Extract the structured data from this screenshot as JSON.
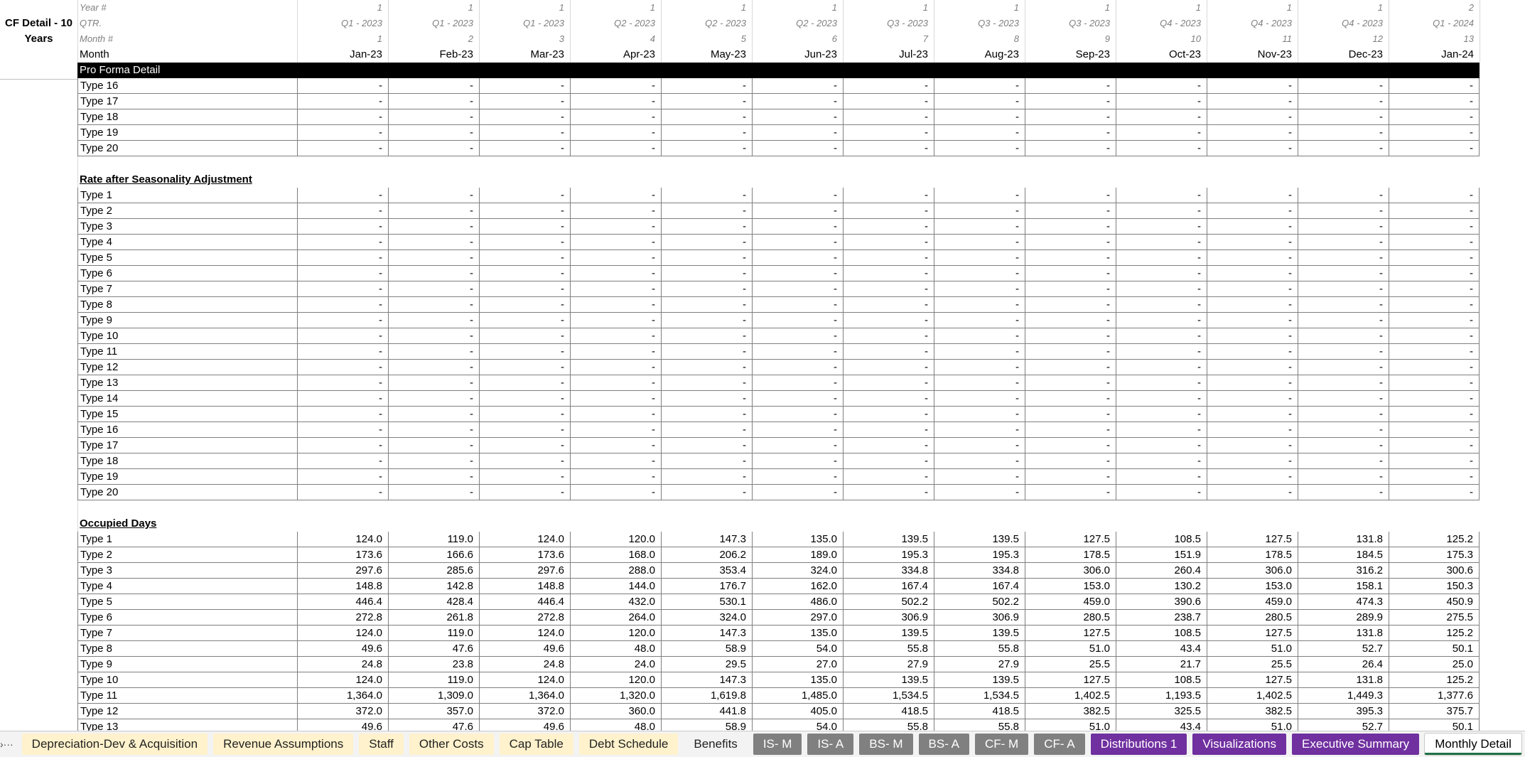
{
  "sheet_title": "CF Detail - 10 Years",
  "header_rows": [
    {
      "label": "Year #",
      "values": [
        "1",
        "1",
        "1",
        "1",
        "1",
        "1",
        "1",
        "1",
        "1",
        "1",
        "1",
        "1",
        "2"
      ],
      "style": "hdr"
    },
    {
      "label": "QTR.",
      "values": [
        "Q1 - 2023",
        "Q1 - 2023",
        "Q1 - 2023",
        "Q2 - 2023",
        "Q2 - 2023",
        "Q2 - 2023",
        "Q3 - 2023",
        "Q3 - 2023",
        "Q3 - 2023",
        "Q4 - 2023",
        "Q4 - 2023",
        "Q4 - 2023",
        "Q1 - 2024"
      ],
      "style": "hdr"
    },
    {
      "label": "Month #",
      "values": [
        "1",
        "2",
        "3",
        "4",
        "5",
        "6",
        "7",
        "8",
        "9",
        "10",
        "11",
        "12",
        "13"
      ],
      "style": "hdr"
    },
    {
      "label": "Month",
      "values": [
        "Jan-23",
        "Feb-23",
        "Mar-23",
        "Apr-23",
        "May-23",
        "Jun-23",
        "Jul-23",
        "Aug-23",
        "Sep-23",
        "Oct-23",
        "Nov-23",
        "Dec-23",
        "Jan-24"
      ],
      "style": "month"
    }
  ],
  "banner": "Pro Forma Detail",
  "block1_rows": [
    {
      "label": "Type 16",
      "values": [
        "-",
        "-",
        "-",
        "-",
        "-",
        "-",
        "-",
        "-",
        "-",
        "-",
        "-",
        "-",
        "-"
      ]
    },
    {
      "label": "Type 17",
      "values": [
        "-",
        "-",
        "-",
        "-",
        "-",
        "-",
        "-",
        "-",
        "-",
        "-",
        "-",
        "-",
        "-"
      ]
    },
    {
      "label": "Type 18",
      "values": [
        "-",
        "-",
        "-",
        "-",
        "-",
        "-",
        "-",
        "-",
        "-",
        "-",
        "-",
        "-",
        "-"
      ]
    },
    {
      "label": "Type 19",
      "values": [
        "-",
        "-",
        "-",
        "-",
        "-",
        "-",
        "-",
        "-",
        "-",
        "-",
        "-",
        "-",
        "-"
      ]
    },
    {
      "label": "Type 20",
      "values": [
        "-",
        "-",
        "-",
        "-",
        "-",
        "-",
        "-",
        "-",
        "-",
        "-",
        "-",
        "-",
        "-"
      ]
    }
  ],
  "section2_title": "Rate after Seasonality Adjustment",
  "section2_rows": [
    {
      "label": "Type 1",
      "values": [
        "-",
        "-",
        "-",
        "-",
        "-",
        "-",
        "-",
        "-",
        "-",
        "-",
        "-",
        "-",
        "-"
      ]
    },
    {
      "label": "Type 2",
      "values": [
        "-",
        "-",
        "-",
        "-",
        "-",
        "-",
        "-",
        "-",
        "-",
        "-",
        "-",
        "-",
        "-"
      ]
    },
    {
      "label": "Type 3",
      "values": [
        "-",
        "-",
        "-",
        "-",
        "-",
        "-",
        "-",
        "-",
        "-",
        "-",
        "-",
        "-",
        "-"
      ]
    },
    {
      "label": "Type 4",
      "values": [
        "-",
        "-",
        "-",
        "-",
        "-",
        "-",
        "-",
        "-",
        "-",
        "-",
        "-",
        "-",
        "-"
      ]
    },
    {
      "label": "Type 5",
      "values": [
        "-",
        "-",
        "-",
        "-",
        "-",
        "-",
        "-",
        "-",
        "-",
        "-",
        "-",
        "-",
        "-"
      ]
    },
    {
      "label": "Type 6",
      "values": [
        "-",
        "-",
        "-",
        "-",
        "-",
        "-",
        "-",
        "-",
        "-",
        "-",
        "-",
        "-",
        "-"
      ]
    },
    {
      "label": "Type 7",
      "values": [
        "-",
        "-",
        "-",
        "-",
        "-",
        "-",
        "-",
        "-",
        "-",
        "-",
        "-",
        "-",
        "-"
      ]
    },
    {
      "label": "Type 8",
      "values": [
        "-",
        "-",
        "-",
        "-",
        "-",
        "-",
        "-",
        "-",
        "-",
        "-",
        "-",
        "-",
        "-"
      ]
    },
    {
      "label": "Type 9",
      "values": [
        "-",
        "-",
        "-",
        "-",
        "-",
        "-",
        "-",
        "-",
        "-",
        "-",
        "-",
        "-",
        "-"
      ]
    },
    {
      "label": "Type 10",
      "values": [
        "-",
        "-",
        "-",
        "-",
        "-",
        "-",
        "-",
        "-",
        "-",
        "-",
        "-",
        "-",
        "-"
      ]
    },
    {
      "label": "Type 11",
      "values": [
        "-",
        "-",
        "-",
        "-",
        "-",
        "-",
        "-",
        "-",
        "-",
        "-",
        "-",
        "-",
        "-"
      ]
    },
    {
      "label": "Type 12",
      "values": [
        "-",
        "-",
        "-",
        "-",
        "-",
        "-",
        "-",
        "-",
        "-",
        "-",
        "-",
        "-",
        "-"
      ]
    },
    {
      "label": "Type 13",
      "values": [
        "-",
        "-",
        "-",
        "-",
        "-",
        "-",
        "-",
        "-",
        "-",
        "-",
        "-",
        "-",
        "-"
      ]
    },
    {
      "label": "Type 14",
      "values": [
        "-",
        "-",
        "-",
        "-",
        "-",
        "-",
        "-",
        "-",
        "-",
        "-",
        "-",
        "-",
        "-"
      ]
    },
    {
      "label": "Type 15",
      "values": [
        "-",
        "-",
        "-",
        "-",
        "-",
        "-",
        "-",
        "-",
        "-",
        "-",
        "-",
        "-",
        "-"
      ]
    },
    {
      "label": "Type 16",
      "values": [
        "-",
        "-",
        "-",
        "-",
        "-",
        "-",
        "-",
        "-",
        "-",
        "-",
        "-",
        "-",
        "-"
      ]
    },
    {
      "label": "Type 17",
      "values": [
        "-",
        "-",
        "-",
        "-",
        "-",
        "-",
        "-",
        "-",
        "-",
        "-",
        "-",
        "-",
        "-"
      ]
    },
    {
      "label": "Type 18",
      "values": [
        "-",
        "-",
        "-",
        "-",
        "-",
        "-",
        "-",
        "-",
        "-",
        "-",
        "-",
        "-",
        "-"
      ]
    },
    {
      "label": "Type 19",
      "values": [
        "-",
        "-",
        "-",
        "-",
        "-",
        "-",
        "-",
        "-",
        "-",
        "-",
        "-",
        "-",
        "-"
      ]
    },
    {
      "label": "Type 20",
      "values": [
        "-",
        "-",
        "-",
        "-",
        "-",
        "-",
        "-",
        "-",
        "-",
        "-",
        "-",
        "-",
        "-"
      ]
    }
  ],
  "section3_title": "Occupied Days",
  "section3_rows": [
    {
      "label": "Type 1",
      "values": [
        "124.0",
        "119.0",
        "124.0",
        "120.0",
        "147.3",
        "135.0",
        "139.5",
        "139.5",
        "127.5",
        "108.5",
        "127.5",
        "131.8",
        "125.2"
      ]
    },
    {
      "label": "Type 2",
      "values": [
        "173.6",
        "166.6",
        "173.6",
        "168.0",
        "206.2",
        "189.0",
        "195.3",
        "195.3",
        "178.5",
        "151.9",
        "178.5",
        "184.5",
        "175.3"
      ]
    },
    {
      "label": "Type 3",
      "values": [
        "297.6",
        "285.6",
        "297.6",
        "288.0",
        "353.4",
        "324.0",
        "334.8",
        "334.8",
        "306.0",
        "260.4",
        "306.0",
        "316.2",
        "300.6"
      ]
    },
    {
      "label": "Type 4",
      "values": [
        "148.8",
        "142.8",
        "148.8",
        "144.0",
        "176.7",
        "162.0",
        "167.4",
        "167.4",
        "153.0",
        "130.2",
        "153.0",
        "158.1",
        "150.3"
      ]
    },
    {
      "label": "Type 5",
      "values": [
        "446.4",
        "428.4",
        "446.4",
        "432.0",
        "530.1",
        "486.0",
        "502.2",
        "502.2",
        "459.0",
        "390.6",
        "459.0",
        "474.3",
        "450.9"
      ]
    },
    {
      "label": "Type 6",
      "values": [
        "272.8",
        "261.8",
        "272.8",
        "264.0",
        "324.0",
        "297.0",
        "306.9",
        "306.9",
        "280.5",
        "238.7",
        "280.5",
        "289.9",
        "275.5"
      ]
    },
    {
      "label": "Type 7",
      "values": [
        "124.0",
        "119.0",
        "124.0",
        "120.0",
        "147.3",
        "135.0",
        "139.5",
        "139.5",
        "127.5",
        "108.5",
        "127.5",
        "131.8",
        "125.2"
      ]
    },
    {
      "label": "Type 8",
      "values": [
        "49.6",
        "47.6",
        "49.6",
        "48.0",
        "58.9",
        "54.0",
        "55.8",
        "55.8",
        "51.0",
        "43.4",
        "51.0",
        "52.7",
        "50.1"
      ]
    },
    {
      "label": "Type 9",
      "values": [
        "24.8",
        "23.8",
        "24.8",
        "24.0",
        "29.5",
        "27.0",
        "27.9",
        "27.9",
        "25.5",
        "21.7",
        "25.5",
        "26.4",
        "25.0"
      ]
    },
    {
      "label": "Type 10",
      "values": [
        "124.0",
        "119.0",
        "124.0",
        "120.0",
        "147.3",
        "135.0",
        "139.5",
        "139.5",
        "127.5",
        "108.5",
        "127.5",
        "131.8",
        "125.2"
      ]
    },
    {
      "label": "Type 11",
      "values": [
        "1,364.0",
        "1,309.0",
        "1,364.0",
        "1,320.0",
        "1,619.8",
        "1,485.0",
        "1,534.5",
        "1,534.5",
        "1,402.5",
        "1,193.5",
        "1,402.5",
        "1,449.3",
        "1,377.6"
      ]
    },
    {
      "label": "Type 12",
      "values": [
        "372.0",
        "357.0",
        "372.0",
        "360.0",
        "441.8",
        "405.0",
        "418.5",
        "418.5",
        "382.5",
        "325.5",
        "382.5",
        "395.3",
        "375.7"
      ]
    },
    {
      "label": "Type 13",
      "values": [
        "49.6",
        "47.6",
        "49.6",
        "48.0",
        "58.9",
        "54.0",
        "55.8",
        "55.8",
        "51.0",
        "43.4",
        "51.0",
        "52.7",
        "50.1"
      ]
    }
  ],
  "tabbar": {
    "nav_prev": "›",
    "nav_more": "···",
    "tabs": [
      {
        "label": "Depreciation-Dev & Acquisition",
        "style": "yellow"
      },
      {
        "label": "Revenue Assumptions",
        "style": "yellow"
      },
      {
        "label": "Staff",
        "style": "yellow"
      },
      {
        "label": "Other Costs",
        "style": "yellow"
      },
      {
        "label": "Cap Table",
        "style": "yellow"
      },
      {
        "label": "Debt Schedule",
        "style": "yellow"
      },
      {
        "label": "Benefits",
        "style": "plain"
      },
      {
        "label": "IS- M",
        "style": "gray"
      },
      {
        "label": "IS- A",
        "style": "gray"
      },
      {
        "label": "BS- M",
        "style": "gray"
      },
      {
        "label": "BS- A",
        "style": "gray"
      },
      {
        "label": "CF- M",
        "style": "gray"
      },
      {
        "label": "CF- A",
        "style": "gray"
      },
      {
        "label": "Distributions 1",
        "style": "purple"
      },
      {
        "label": "Visualizations",
        "style": "purple"
      },
      {
        "label": "Executive Summary",
        "style": "purple"
      },
      {
        "label": "Monthly Detail",
        "style": "active"
      }
    ]
  }
}
